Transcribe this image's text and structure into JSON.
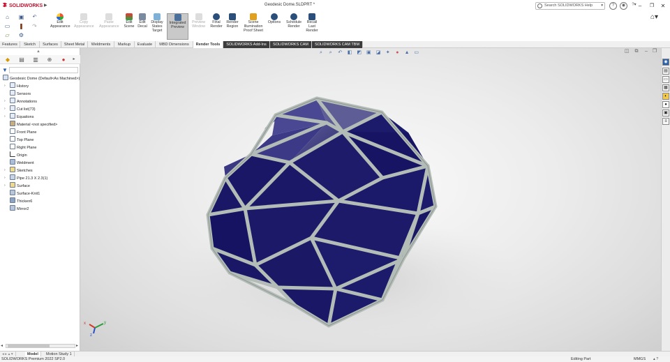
{
  "app": {
    "brand": "SOLIDWORKS",
    "document_title": "Geodesic Dome.SLDPRT *",
    "search_placeholder": "Search SOLIDWORKS Help"
  },
  "ribbon": [
    {
      "label": "Edit\nAppearance",
      "state": "enabled"
    },
    {
      "label": "Copy\nAppearance",
      "state": "disabled"
    },
    {
      "label": "Paste\nAppearance",
      "state": "disabled"
    },
    {
      "label": "Edit\nScene",
      "state": "enabled"
    },
    {
      "label": "Edit\nDecal",
      "state": "enabled"
    },
    {
      "label": "Display\nStates\nTarget",
      "state": "enabled"
    },
    {
      "label": "Integrated\nPreview",
      "state": "active"
    },
    {
      "label": "Preview\nWindow",
      "state": "disabled"
    },
    {
      "label": "Final\nRender",
      "state": "enabled"
    },
    {
      "label": "Render\nRegion",
      "state": "enabled"
    },
    {
      "label": "Scene\nIllumination\nProof Sheet",
      "state": "enabled"
    },
    {
      "label": "Options",
      "state": "enabled"
    },
    {
      "label": "Schedule\nRender",
      "state": "enabled"
    },
    {
      "label": "Recall\nLast\nRender",
      "state": "enabled"
    }
  ],
  "tabs": [
    "Features",
    "Sketch",
    "Surfaces",
    "Sheet Metal",
    "Weldments",
    "Markup",
    "Evaluate",
    "MBD Dimensions",
    "Render Tools",
    "SOLIDWORKS Add-Ins",
    "SOLIDWORKS CAM",
    "SOLIDWORKS CAM TBM"
  ],
  "active_tab": "Render Tools",
  "tree": {
    "root": "Geodesic Dome (Default<As Machined>)",
    "items": [
      {
        "label": "History",
        "expandable": true
      },
      {
        "label": "Sensors",
        "expandable": false
      },
      {
        "label": "Annotations",
        "expandable": true
      },
      {
        "label": "Cut list(73)",
        "expandable": true
      },
      {
        "label": "Equations",
        "expandable": true
      },
      {
        "label": "Material <not specified>",
        "expandable": false
      },
      {
        "label": "Front Plane",
        "expandable": false
      },
      {
        "label": "Top Plane",
        "expandable": false
      },
      {
        "label": "Right Plane",
        "expandable": false
      },
      {
        "label": "Origin",
        "expandable": false
      },
      {
        "label": "Weldment",
        "expandable": false
      },
      {
        "label": "Sketches",
        "expandable": true
      },
      {
        "label": "Pipe 21.3 X 2.3(1)",
        "expandable": true
      },
      {
        "label": "Surface",
        "expandable": true
      },
      {
        "label": "Surface-Knit1",
        "expandable": false
      },
      {
        "label": "Thicken6",
        "expandable": false
      },
      {
        "label": "Mirror2",
        "expandable": false
      }
    ]
  },
  "bottom_tabs": [
    "Model",
    "Motion Study 1"
  ],
  "status": {
    "version": "SOLIDWORKS Premium 2022 SP2.0",
    "mode": "Editing Part",
    "units": "MMGS"
  },
  "triad": {
    "x": "x",
    "y": "y",
    "z": "z"
  },
  "colors": {
    "glass": "#1c1b6b",
    "frame": "#b4bcb7",
    "accent": "#c8102e"
  }
}
